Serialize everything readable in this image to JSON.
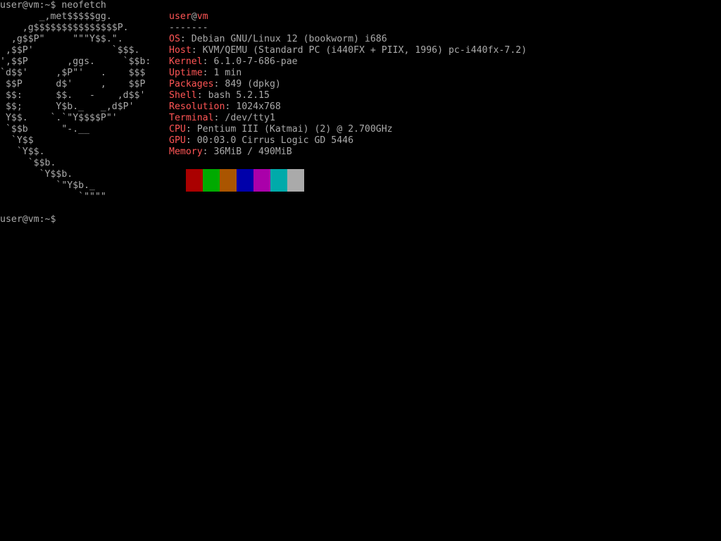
{
  "terminal": {
    "prompt": "user@vm:~$",
    "command": " neofetch",
    "final_prompt": "user@vm:~$"
  },
  "logo": {
    "lines": [
      "       _,met$$$$$gg.",
      "    ,g$$$$$$$$$$$$$$$P.",
      "  ,g$$P\"     \"\"\"Y$$.\".",
      " ,$$P'              `$$$.",
      "',$$P       ,ggs.     `$$b:",
      "`d$$'     ,$P\"'   .    $$$",
      " $$P      d$'     ,    $$P",
      " $$:      $$.   -    ,d$$'",
      " $$;      Y$b._   _,d$P'",
      " Y$$.    `.`\"Y$$$$P\"'",
      " `$$b      \"-.__",
      "  `Y$$",
      "   `Y$$.",
      "     `$$b.",
      "       `Y$$b.",
      "          `\"Y$b._",
      "              `\"\"\"\""
    ]
  },
  "info": {
    "title_user": "user",
    "title_at": "@",
    "title_host": "vm",
    "separator": "-------",
    "rows": [
      {
        "key": "OS",
        "value": "Debian GNU/Linux 12 (bookworm) i686"
      },
      {
        "key": "Host",
        "value": "KVM/QEMU (Standard PC (i440FX + PIIX, 1996) pc-i440fx-7.2)"
      },
      {
        "key": "Kernel",
        "value": "6.1.0-7-686-pae"
      },
      {
        "key": "Uptime",
        "value": "1 min"
      },
      {
        "key": "Packages",
        "value": "849 (dpkg)"
      },
      {
        "key": "Shell",
        "value": "bash 5.2.15"
      },
      {
        "key": "Resolution",
        "value": "1024x768"
      },
      {
        "key": "Terminal",
        "value": "/dev/tty1"
      },
      {
        "key": "CPU",
        "value": "Pentium III (Katmai) (2) @ 2.700GHz"
      },
      {
        "key": "GPU",
        "value": "00:03.0 Cirrus Logic GD 5446"
      },
      {
        "key": "Memory",
        "value": "36MiB / 490MiB"
      }
    ],
    "key_suffix": ": "
  },
  "colors": {
    "background": "#000000",
    "foreground": "#aaaaaa",
    "accent_red": "#ff5555",
    "palette": [
      "#000000",
      "#aa0000",
      "#00aa00",
      "#aa5500",
      "#0000aa",
      "#aa00aa",
      "#00aaaa",
      "#aaaaaa"
    ]
  }
}
